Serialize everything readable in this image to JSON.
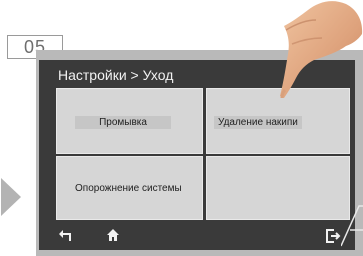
{
  "step_number": "05",
  "screen": {
    "title": "Настройки > Уход",
    "tiles": [
      {
        "label": "Промывка"
      },
      {
        "label": "Удаление накипи"
      },
      {
        "label": "Опорожнение системы"
      },
      {
        "label": ""
      }
    ]
  },
  "bottom_bar": {
    "left_icons": [
      "back-arrow-icon",
      "home-icon"
    ],
    "right_icons": [
      "exit-icon"
    ]
  },
  "colors": {
    "screen_bg": "#3a3a3a",
    "tile_bg": "#d6d6d6",
    "device_frame": "#b9b9b9"
  }
}
